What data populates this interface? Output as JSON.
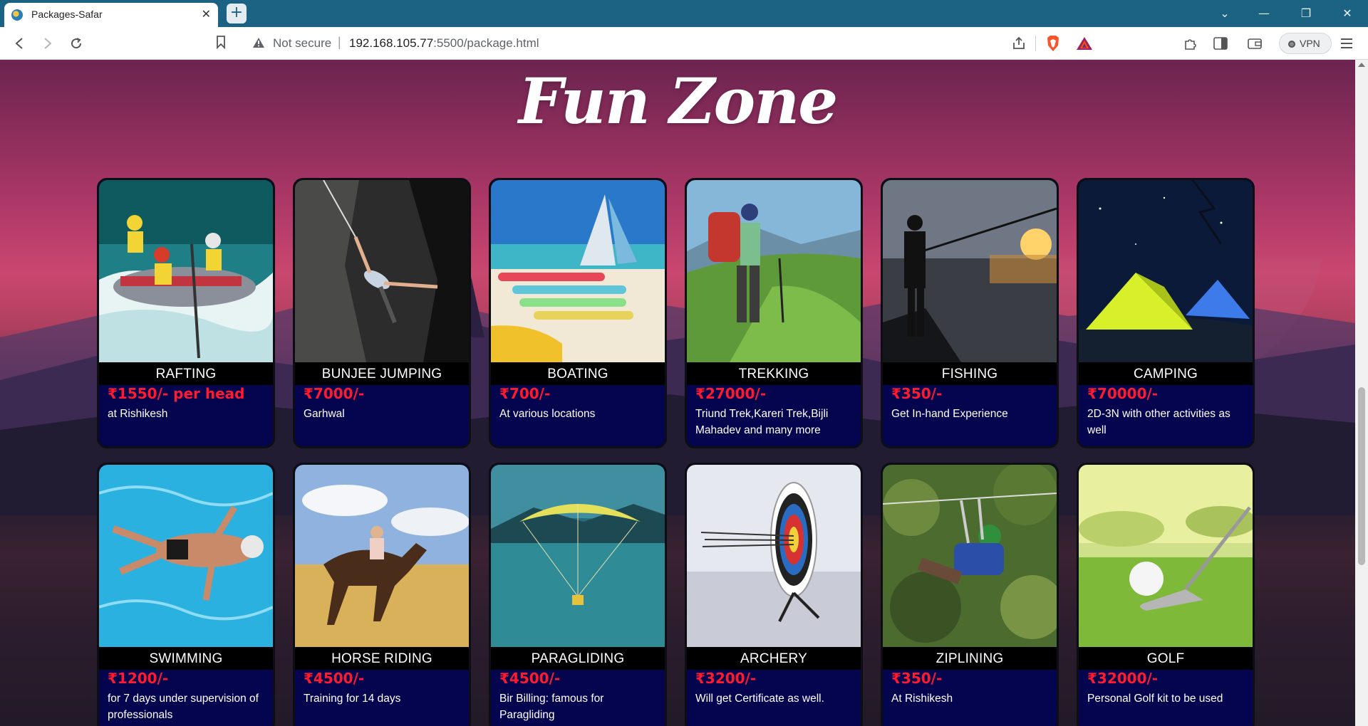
{
  "browser": {
    "tab_title": "Packages-Safar",
    "new_tab_label": "+",
    "not_secure_label": "Not secure",
    "url_host": "192.168.105.77",
    "url_rest": ":5500/package.html",
    "vpn_label": "VPN"
  },
  "page": {
    "heading": "Fun Zone"
  },
  "packages": [
    {
      "title": "RAFTING",
      "price": "₹1550/- per head",
      "description": "at Rishikesh"
    },
    {
      "title": "BUNJEE JUMPING",
      "price": "₹7000/-",
      "description": "Garhwal"
    },
    {
      "title": "BOATING",
      "price": "₹700/-",
      "description": "At various locations"
    },
    {
      "title": "TREKKING",
      "price": "₹27000/-",
      "description": "Triund Trek,Kareri Trek,Bijli Mahadev and many more"
    },
    {
      "title": "FISHING",
      "price": "₹350/-",
      "description": "Get In-hand Experience"
    },
    {
      "title": "CAMPING",
      "price": "₹70000/-",
      "description": "2D-3N with other activities as well"
    },
    {
      "title": "SWIMMING",
      "price": "₹1200/-",
      "description": "for 7 days under supervision of professionals"
    },
    {
      "title": "HORSE RIDING",
      "price": "₹4500/-",
      "description": "Training for 14 days"
    },
    {
      "title": "PARAGLIDING",
      "price": "₹4500/-",
      "description": "Bir Billing: famous for Paragliding"
    },
    {
      "title": "ARCHERY",
      "price": "₹3200/-",
      "description": "Will get Certificate as well."
    },
    {
      "title": "ZIPLINING",
      "price": "₹350/-",
      "description": "At Rishikesh"
    },
    {
      "title": "GOLF",
      "price": "₹32000/-",
      "description": "Personal Golf kit to be used"
    }
  ],
  "colors": {
    "price": "#ff1a2e",
    "card_body": "#04044f",
    "tab_strip": "#1c6283"
  },
  "icons": {
    "back": "arrow-left-icon",
    "forward": "arrow-right-icon",
    "reload": "reload-icon",
    "bookmark": "bookmark-icon",
    "warning": "warning-icon",
    "share": "share-icon",
    "brave": "brave-shield-icon",
    "rewards": "brave-rewards-icon",
    "extensions": "puzzle-icon",
    "sidebar": "sidebar-icon",
    "wallet": "wallet-icon",
    "menu": "hamburger-menu-icon"
  }
}
